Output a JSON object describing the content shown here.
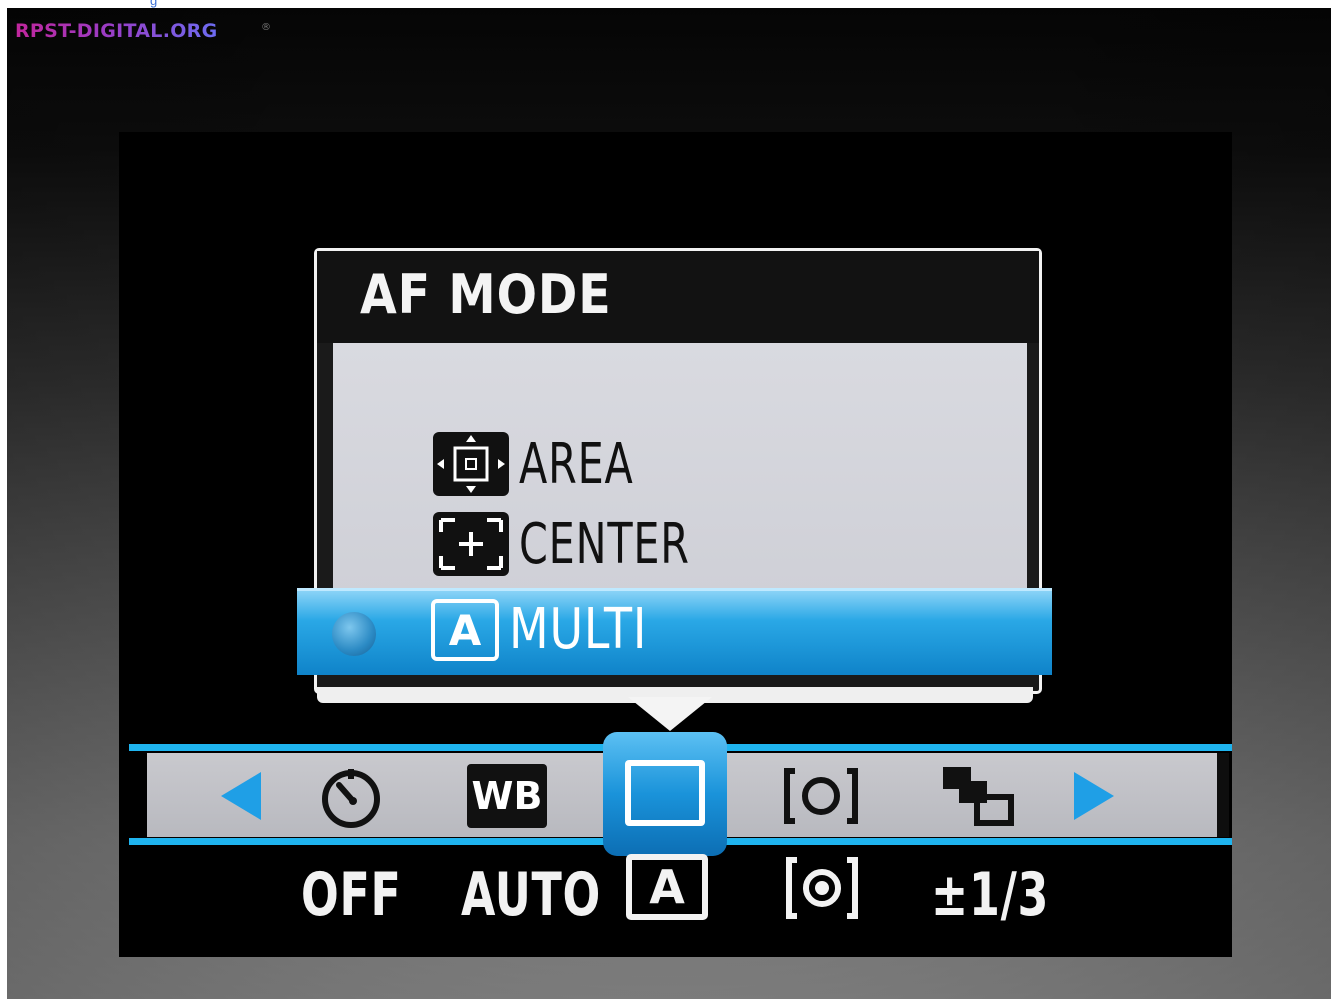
{
  "watermark": "RPST-DIGITAL.ORG",
  "top_link": "g",
  "menu": {
    "title": "AF MODE",
    "items": [
      {
        "label": "AREA",
        "icon": "af-area-icon"
      },
      {
        "label": "CENTER",
        "icon": "af-center-icon"
      },
      {
        "label": "MULTI",
        "icon": "af-multi-icon",
        "selected": true
      }
    ]
  },
  "strip": {
    "settings": [
      {
        "icon": "self-timer-icon",
        "value": "OFF"
      },
      {
        "icon": "white-balance-icon",
        "icon_text": "WB",
        "value": "AUTO"
      },
      {
        "icon": "af-frame-icon",
        "value_icon": "af-multi-icon",
        "value_icon_text": "A",
        "active": true
      },
      {
        "icon": "metering-icon",
        "value_icon": "metering-icon"
      },
      {
        "icon": "exposure-bracketing-icon",
        "value": "±1/3"
      }
    ]
  },
  "colors": {
    "accent": "#1fb4ef",
    "highlight": "#1a93da",
    "menu_body": "#d3d4da",
    "lcd_background": "#000000"
  }
}
